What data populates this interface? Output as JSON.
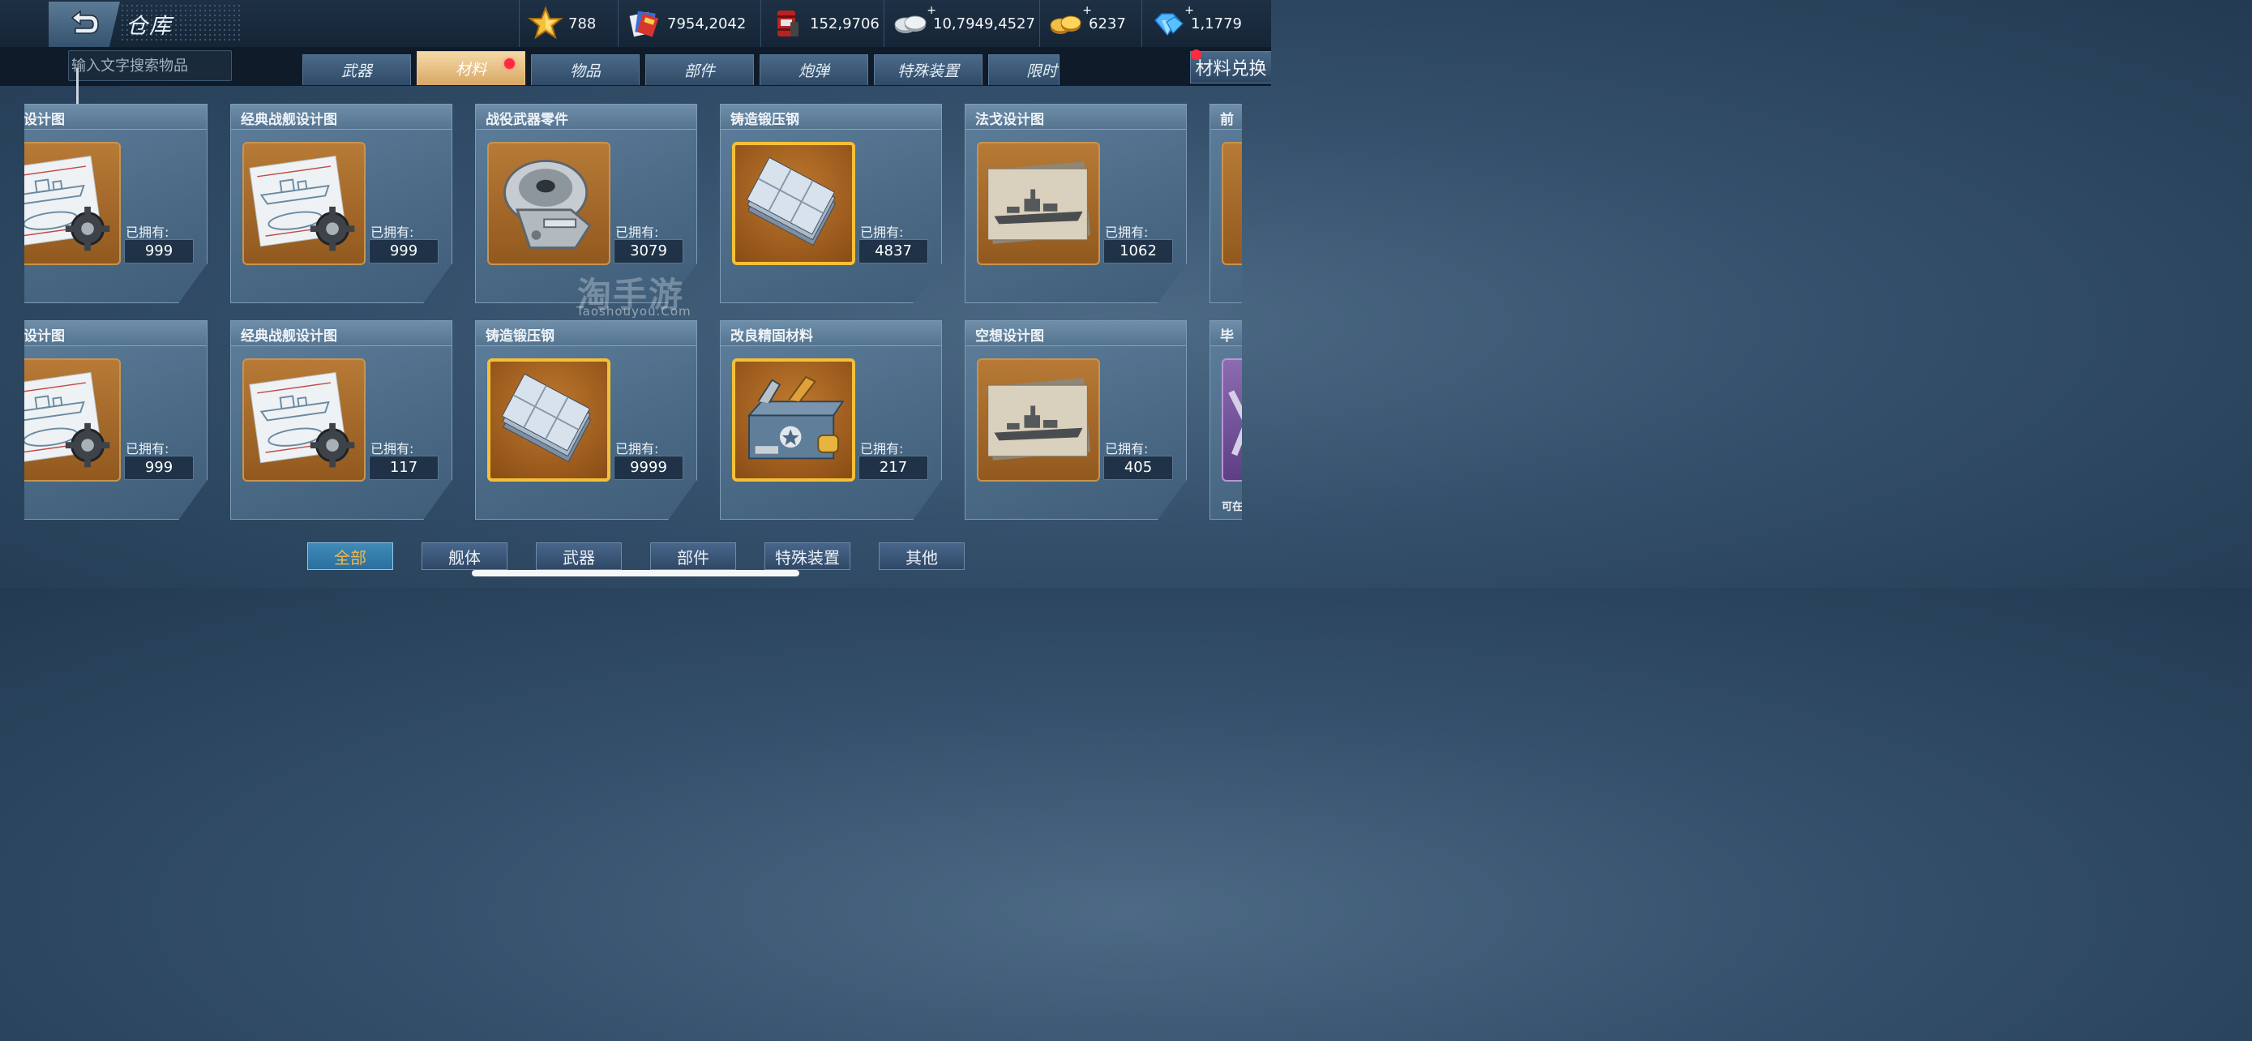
{
  "header": {
    "title": "仓库",
    "back_icon": "back-arrow-icon",
    "currencies": [
      {
        "name": "star",
        "icon": "star-icon",
        "value": "788",
        "plus": ""
      },
      {
        "name": "flags",
        "icon": "flag-pack-icon",
        "value": "7954,2042",
        "plus": ""
      },
      {
        "name": "oil",
        "icon": "oil-barrel-icon",
        "value": "152,9706",
        "plus": ""
      },
      {
        "name": "silver",
        "icon": "silver-coins-icon",
        "value": "10,7949,4527",
        "plus": "+"
      },
      {
        "name": "gold",
        "icon": "gold-coins-icon",
        "value": "6237",
        "plus": "+"
      },
      {
        "name": "diamond",
        "icon": "diamond-icon",
        "value": "1,1779",
        "plus": "+"
      }
    ]
  },
  "search": {
    "placeholder": "输入文字搜索物品"
  },
  "tabs": [
    {
      "label": "武器",
      "active": false
    },
    {
      "label": "材料",
      "active": true,
      "badge": true
    },
    {
      "label": "物品",
      "active": false
    },
    {
      "label": "部件",
      "active": false
    },
    {
      "label": "炮弹",
      "active": false
    },
    {
      "label": "特殊装置",
      "active": false
    },
    {
      "label": "限时",
      "active": false
    }
  ],
  "exchange": {
    "label": "材料兑换",
    "badge": true
  },
  "owned_label": "已拥有:",
  "items": [
    {
      "name": "战舰设计图",
      "count": "999",
      "image": "blueprint-gear"
    },
    {
      "name": "经典战舰设计图",
      "count": "999",
      "image": "blueprint-gear"
    },
    {
      "name": "战役武器零件",
      "count": "3079",
      "image": "metal-part"
    },
    {
      "name": "铸造锻压钢",
      "count": "4837",
      "image": "steel-plates"
    },
    {
      "name": "法戈设计图",
      "count": "1062",
      "image": "ship-photo"
    },
    {
      "name": "前",
      "count": "",
      "image": "partial"
    },
    {
      "name": "战舰设计图",
      "count": "999",
      "image": "blueprint-gear"
    },
    {
      "name": "经典战舰设计图",
      "count": "117",
      "image": "blueprint-gear"
    },
    {
      "name": "铸造锻压钢",
      "count": "9999",
      "image": "steel-plates"
    },
    {
      "name": "改良精固材料",
      "count": "217",
      "image": "toolbox"
    },
    {
      "name": "空想设计图",
      "count": "405",
      "image": "ship-photo"
    },
    {
      "name": "毕",
      "count": "",
      "image": "partial-purple",
      "note": "可在"
    }
  ],
  "watermark": {
    "main": "淘手游",
    "sub": "Taoshouyou.Com"
  },
  "filters": [
    {
      "label": "全部",
      "active": true
    },
    {
      "label": "舰体",
      "active": false
    },
    {
      "label": "武器",
      "active": false
    },
    {
      "label": "部件",
      "active": false
    },
    {
      "label": "特殊装置",
      "active": false
    },
    {
      "label": "其他",
      "active": false
    }
  ],
  "colors": {
    "active_tab": "#e4b877",
    "badge": "#ff2a3d",
    "filter_active_text": "#f5b64a"
  }
}
